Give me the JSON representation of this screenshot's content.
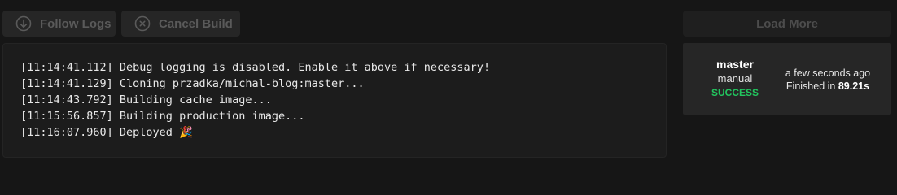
{
  "toolbar": {
    "follow_label": "Follow Logs",
    "cancel_label": "Cancel Build",
    "load_more_label": "Load More"
  },
  "log": {
    "lines": [
      "[11:14:41.112] Debug logging is disabled. Enable it above if necessary!",
      "[11:14:41.129] Cloning przadka/michal-blog:master...",
      "[11:14:43.792] Building cache image...",
      "[11:15:56.857] Building production image...",
      "[11:16:07.960] Deployed 🎉"
    ]
  },
  "build": {
    "branch": "master",
    "trigger": "manual",
    "status": "SUCCESS",
    "relative_time": "a few seconds ago",
    "finished_prefix": "Finished in ",
    "duration": "89.21s"
  },
  "colors": {
    "background": "#161616",
    "panel": "#1c1c1c",
    "success": "#22c55e",
    "disabled_text": "#5a5a5a"
  },
  "icons": {
    "follow": "arrow-down-circle-icon",
    "cancel": "x-circle-icon"
  }
}
